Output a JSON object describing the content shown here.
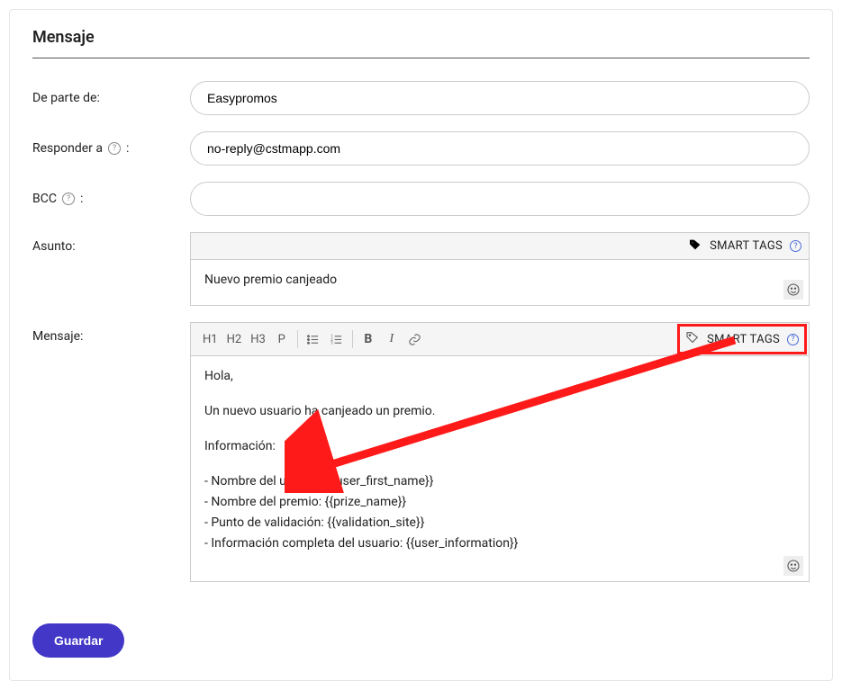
{
  "section": {
    "title": "Mensaje"
  },
  "labels": {
    "from": "De parte de:",
    "reply_to": "Responder a",
    "reply_to_suffix": ":",
    "bcc": "BCC",
    "bcc_suffix": ":",
    "subject": "Asunto:",
    "message": "Mensaje:"
  },
  "fields": {
    "from": "Easypromos",
    "reply_to": "no-reply@cstmapp.com",
    "bcc": "",
    "subject": "Nuevo premio canjeado"
  },
  "smart_tags_label": "SMART TAGS",
  "toolbar": {
    "h1": "H1",
    "h2": "H2",
    "h3": "H3",
    "p": "P",
    "bold": "B",
    "italic": "I"
  },
  "message_body": {
    "greeting": "Hola,",
    "line1": "Un nuevo usuario ha canjeado un premio.",
    "info_header": "Información:",
    "bullets": [
      "- Nombre del usuario: {{user_first_name}}",
      "- Nombre del premio: {{prize_name}}",
      "- Punto de validación: {{validation_site}}",
      "- Información completa del usuario: {{user_information}}"
    ]
  },
  "buttons": {
    "save": "Guardar"
  },
  "icons": {
    "help": "?",
    "emoji": "😀"
  }
}
